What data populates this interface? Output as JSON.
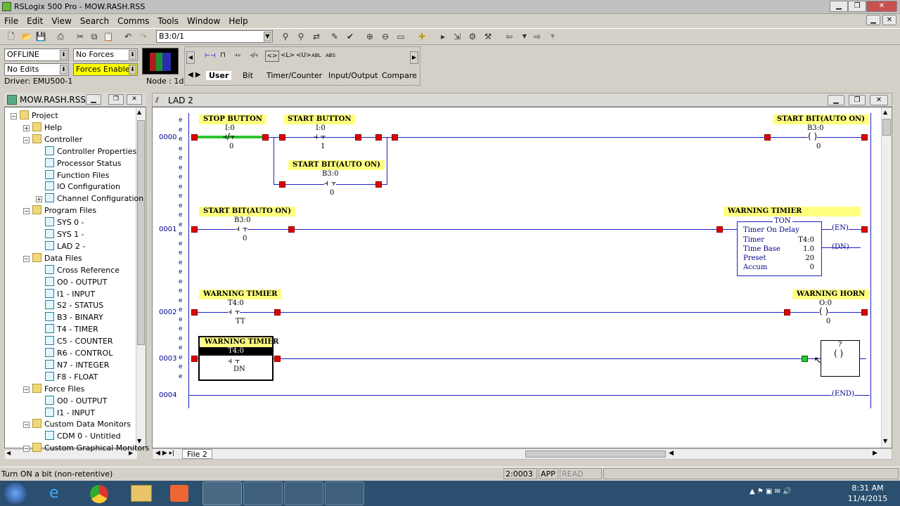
{
  "window": {
    "title": "RSLogix 500 Pro - MOW.RASH.RSS"
  },
  "menu": [
    "File",
    "Edit",
    "View",
    "Search",
    "Comms",
    "Tools",
    "Window",
    "Help"
  ],
  "toolbar": {
    "address": "B3:0/1"
  },
  "status_panel": {
    "mode": "OFFLINE",
    "forces": "No Forces",
    "edits": "No Edits",
    "forces_enabled": "Forces Enabled",
    "driver": "Driver: EMU500-1",
    "node": "Node : 1d"
  },
  "instr_tabs": [
    "User",
    "Bit",
    "Timer/Counter",
    "Input/Output",
    "Compare"
  ],
  "project": {
    "title": "MOW.RASH.RSS",
    "items": [
      {
        "label": "Project",
        "level": 0,
        "icon": "folder",
        "pm": "-"
      },
      {
        "label": "Help",
        "level": 1,
        "icon": "folder",
        "pm": "+"
      },
      {
        "label": "Controller",
        "level": 1,
        "icon": "folder",
        "pm": "-"
      },
      {
        "label": "Controller Properties",
        "level": 2,
        "icon": "info"
      },
      {
        "label": "Processor Status",
        "level": 2,
        "icon": "status"
      },
      {
        "label": "Function Files",
        "level": 2,
        "icon": "status"
      },
      {
        "label": "IO Configuration",
        "level": 2,
        "icon": "io"
      },
      {
        "label": "Channel Configuration",
        "level": 2,
        "icon": "channel",
        "pm": "+"
      },
      {
        "label": "Program Files",
        "level": 1,
        "icon": "folder",
        "pm": "-"
      },
      {
        "label": "SYS 0 -",
        "level": 2,
        "icon": "sys"
      },
      {
        "label": "SYS 1 -",
        "level": 2,
        "icon": "sys"
      },
      {
        "label": "LAD 2 -",
        "level": 2,
        "icon": "lad"
      },
      {
        "label": "Data Files",
        "level": 1,
        "icon": "folder",
        "pm": "-"
      },
      {
        "label": "Cross Reference",
        "level": 2,
        "icon": "xref"
      },
      {
        "label": "O0 - OUTPUT",
        "level": 2,
        "icon": "file"
      },
      {
        "label": "I1 - INPUT",
        "level": 2,
        "icon": "file"
      },
      {
        "label": "S2 - STATUS",
        "level": 2,
        "icon": "file"
      },
      {
        "label": "B3 - BINARY",
        "level": 2,
        "icon": "file"
      },
      {
        "label": "T4 - TIMER",
        "level": 2,
        "icon": "file"
      },
      {
        "label": "C5 - COUNTER",
        "level": 2,
        "icon": "file"
      },
      {
        "label": "R6 - CONTROL",
        "level": 2,
        "icon": "file"
      },
      {
        "label": "N7 - INTEGER",
        "level": 2,
        "icon": "file"
      },
      {
        "label": "F8 - FLOAT",
        "level": 2,
        "icon": "file"
      },
      {
        "label": "Force Files",
        "level": 1,
        "icon": "folder",
        "pm": "-"
      },
      {
        "label": "O0 - OUTPUT",
        "level": 2,
        "icon": "file"
      },
      {
        "label": "I1 - INPUT",
        "level": 2,
        "icon": "file"
      },
      {
        "label": "Custom Data Monitors",
        "level": 1,
        "icon": "folder",
        "pm": "-"
      },
      {
        "label": "CDM 0 - Untitled",
        "level": 2,
        "icon": "file"
      },
      {
        "label": "Custom Graphical Monitors",
        "level": 1,
        "icon": "folder",
        "pm": "-"
      }
    ]
  },
  "ladder": {
    "title": "LAD 2",
    "tab": "File 2",
    "rung0": {
      "num": "0000",
      "c1_label": "STOP BUTTON",
      "c1_addr": "I:0",
      "c1_bit": "0",
      "c2_label": "START BUTTON",
      "c2_addr": "I:0",
      "c2_bit": "1",
      "br_label": "START BIT(AUTO ON)",
      "br_addr": "B3:0",
      "br_bit": "0",
      "coil_label": "START BIT(AUTO ON)",
      "coil_addr": "B3:0",
      "coil_bit": "0"
    },
    "rung1": {
      "num": "0001",
      "c1_label": "START BIT(AUTO ON)",
      "c1_addr": "B3:0",
      "c1_bit": "0",
      "ton_label": "WARNING TIMIER",
      "ton_title": "TON",
      "ton_desc": "Timer On Delay",
      "timer_k": "Timer",
      "timer_v": "T4:0",
      "base_k": "Time Base",
      "base_v": "1.0",
      "preset_k": "Preset",
      "preset_v": "20",
      "accum_k": "Accum",
      "accum_v": "0",
      "en": "EN",
      "dn": "DN"
    },
    "rung2": {
      "num": "0002",
      "c1_label": "WARNING TIMIER",
      "c1_addr": "T4:0",
      "c1_bit": "TT",
      "coil_label": "WARNING HORN",
      "coil_addr": "O:0",
      "coil_bit": "0"
    },
    "rung3": {
      "num": "0003",
      "c1_label": "WARNING TIMIER",
      "c1_addr": "T4:0",
      "c1_bit": "DN",
      "coil_addr": "?"
    },
    "rung4": {
      "num": "0004",
      "end": "END"
    }
  },
  "statusbar": {
    "hint": "Turn ON a bit (non-retentive)",
    "pos": "2:0003",
    "app": "APP",
    "read": "READ"
  },
  "clock": {
    "time": "8:31 AM",
    "date": "11/4/2015"
  }
}
